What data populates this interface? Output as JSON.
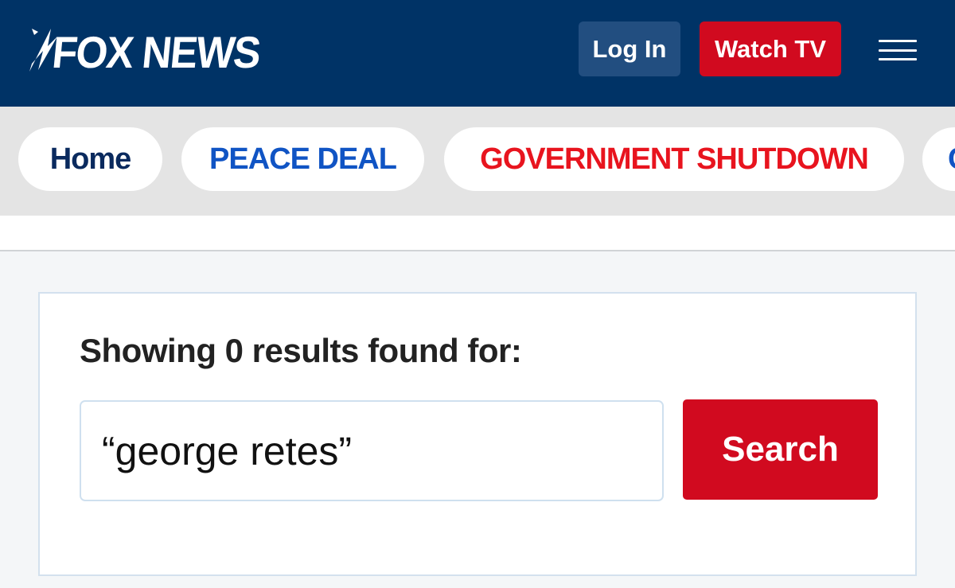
{
  "header": {
    "logo_text": "FOX NEWS",
    "login_label": "Log In",
    "watch_label": "Watch TV",
    "menu_icon": "hamburger-menu-icon"
  },
  "nav": {
    "items": [
      {
        "label": "Home"
      },
      {
        "label": "PEACE DEAL"
      },
      {
        "label": "GOVERNMENT SHUTDOWN"
      },
      {
        "label": "C"
      }
    ]
  },
  "results": {
    "heading": "Showing 0 results found for:",
    "query": "“george retes”",
    "search_label": "Search"
  },
  "colors": {
    "header_bg": "#003366",
    "login_bg": "#224e80",
    "brand_red": "#d10a1f",
    "nav_home": "#0a2a5e",
    "nav_blue": "#1054c4",
    "nav_red": "#e8141e"
  }
}
